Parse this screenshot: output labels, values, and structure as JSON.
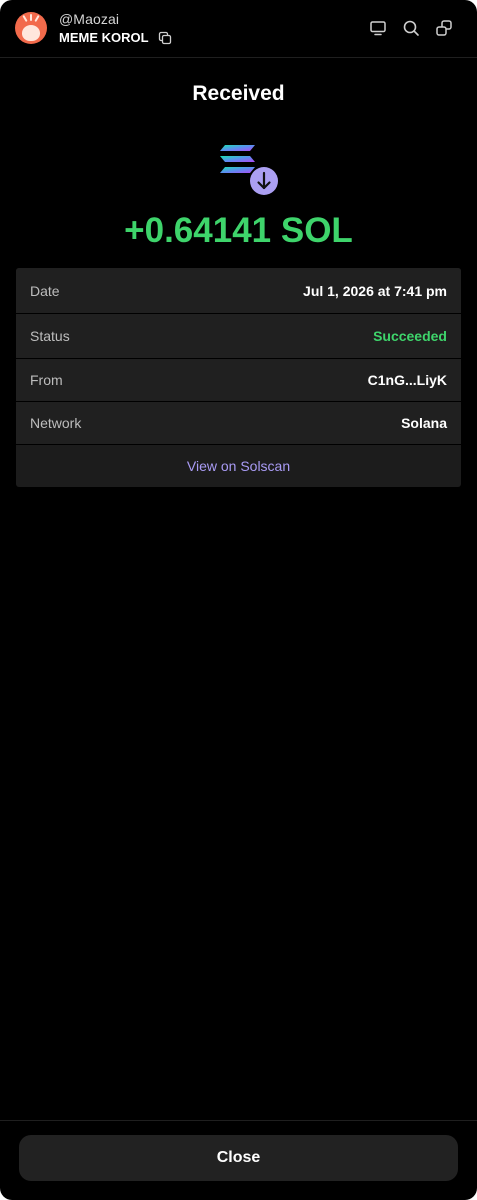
{
  "header": {
    "handle": "@Maozai",
    "account_name": "MEME KOROL",
    "icons": [
      "copy-icon",
      "monitor-icon",
      "search-icon",
      "switch-wallet-icon"
    ]
  },
  "transaction": {
    "title": "Received",
    "token_icon": "solana-receive-icon",
    "amount": "+0.64141 SOL",
    "amount_color": "#3ed46b"
  },
  "details": [
    {
      "label": "Date",
      "value": "Jul 1, 2026 at 7:41 pm"
    },
    {
      "label": "Status",
      "value": "Succeeded"
    },
    {
      "label": "From",
      "value": "C1nG...LiyK"
    },
    {
      "label": "Network",
      "value": "Solana"
    }
  ],
  "link": {
    "label": "View on Solscan",
    "color": "#a99bf4"
  },
  "footer": {
    "close_label": "Close"
  },
  "colors": {
    "background": "#000000",
    "card": "#202020",
    "success": "#3ed46b",
    "accent": "#a99bf4"
  }
}
